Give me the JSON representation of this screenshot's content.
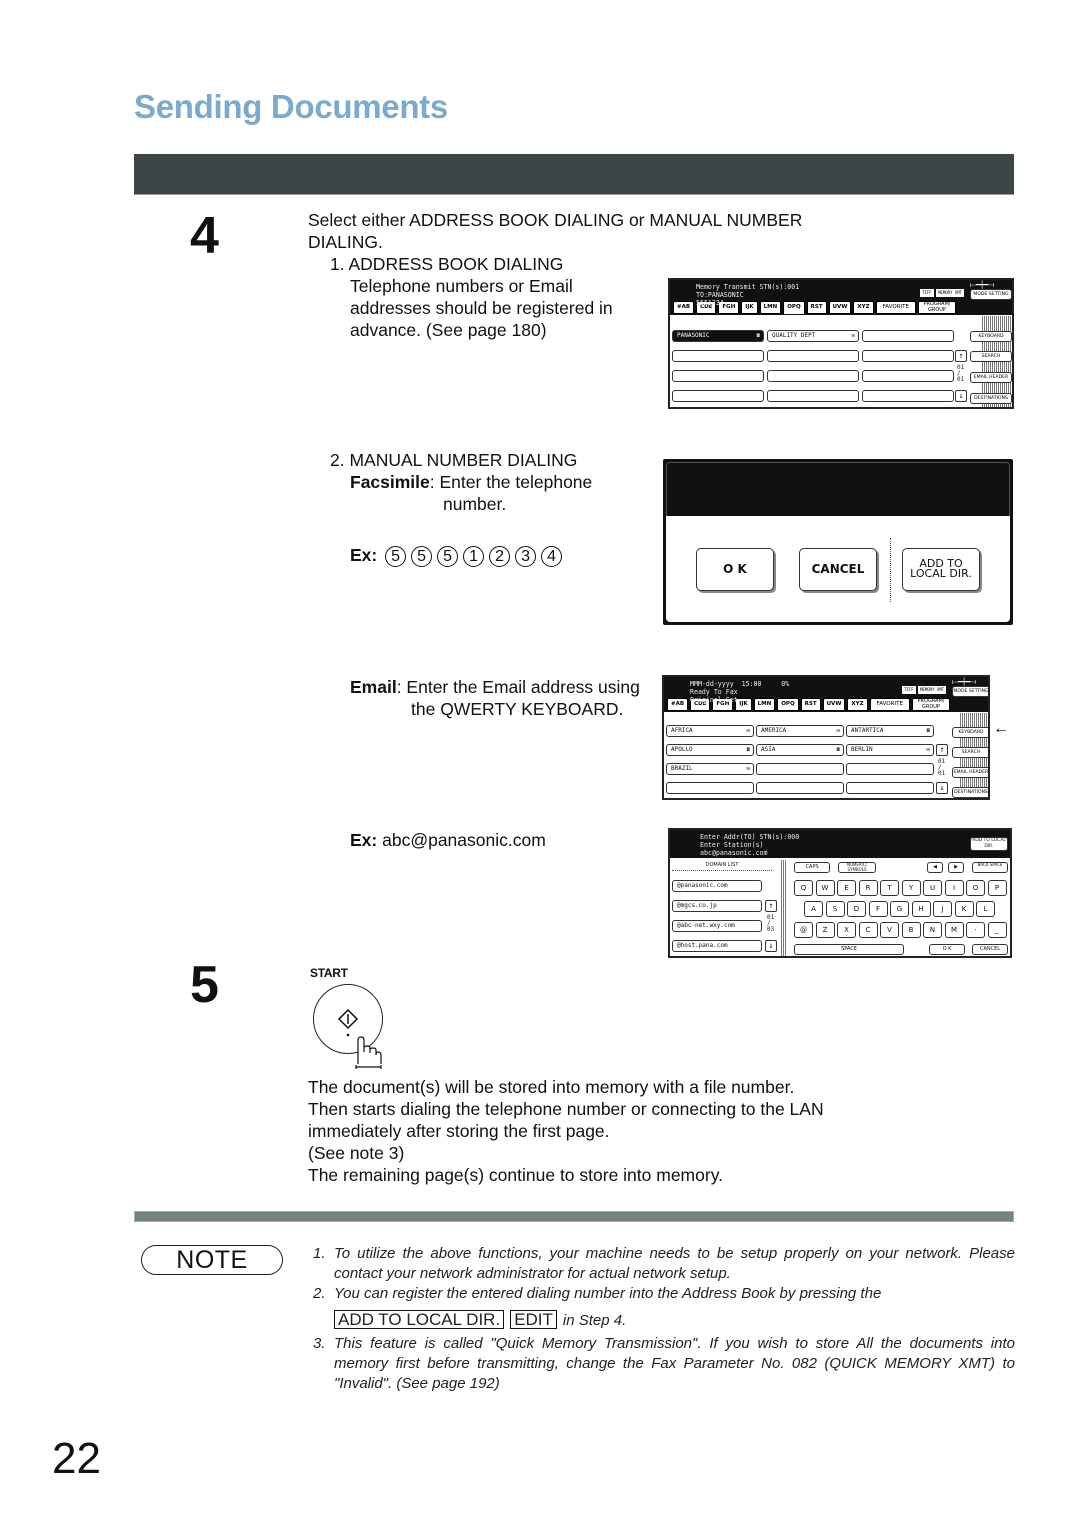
{
  "page": {
    "section_title": "Sending Documents",
    "page_number": "22"
  },
  "step4": {
    "number": "4",
    "intro_line1": "Select either ADDRESS BOOK DIALING or MANUAL NUMBER",
    "intro_line2": "DIALING.",
    "address_book": {
      "heading": "1. ADDRESS BOOK DIALING",
      "lines": [
        "Telephone numbers or Email",
        "addresses should be registered in",
        "advance. (See page 180)"
      ]
    },
    "manual": {
      "heading": "2. MANUAL NUMBER DIALING",
      "fax_label": "Facsimile",
      "fax_text_1": ": Enter the telephone",
      "fax_text_2": "number.",
      "ex_label": "Ex:",
      "ex_digits": [
        "5",
        "5",
        "5",
        "1",
        "2",
        "3",
        "4"
      ],
      "email_label": "Email",
      "email_text_1": ": Enter the Email address using",
      "email_text_2": "the QWERTY KEYBOARD.",
      "email_ex_label": "Ex:",
      "email_ex_value": "abc@panasonic.com"
    }
  },
  "screen_addressbook": {
    "status": [
      "Memory Transmit STN(s):001",
      "TO:PANASONIC",
      "5551234"
    ],
    "indicators": [
      "TIFF",
      "MEMORY XMT"
    ],
    "mode_setting": "MODE SETTING",
    "tabs": [
      "#AB",
      "CDE",
      "FGH",
      "IJK",
      "LMN",
      "OPQ",
      "RST",
      "UVW",
      "XYZ",
      "FAVORITE",
      "PROGRAM/ GROUP"
    ],
    "active_tab": "OPQ",
    "entries": [
      {
        "name": "PANASONIC",
        "type": "phone",
        "selected": true
      },
      {
        "name": "QUALITY DEPT",
        "type": "email",
        "selected": false
      }
    ],
    "side_buttons": [
      "KEYBOARD",
      "SEARCH",
      "EMAIL HEADER",
      "DESTINATIONS"
    ],
    "pager": {
      "current": "01",
      "total": "01"
    }
  },
  "screen_dialog": {
    "ok": "O K",
    "cancel": "CANCEL",
    "add_line1": "ADD TO",
    "add_line2": "LOCAL DIR."
  },
  "screen_ready": {
    "status": [
      "MMM-dd-yyyy  15:00     0%",
      "Ready To Fax",
      "Original Set"
    ],
    "indicators": [
      "TIFF",
      "MEMORY XMT"
    ],
    "mode_setting": "MODE SETTING",
    "tabs": [
      "#AB",
      "CDE",
      "FGH",
      "IJK",
      "LMN",
      "OPQ",
      "RST",
      "UVW",
      "XYZ",
      "FAVORITE",
      "PROGRAM/ GROUP"
    ],
    "entries": [
      {
        "name": "AFRICA",
        "icon": "✉"
      },
      {
        "name": "AMERICA",
        "icon": "✉"
      },
      {
        "name": "ANTARTICA",
        "icon": "☎"
      },
      {
        "name": "APOLLO",
        "icon": "☎"
      },
      {
        "name": "ASIA",
        "icon": "☎"
      },
      {
        "name": "BERLIN",
        "icon": "✉"
      },
      {
        "name": "BRAZIL",
        "icon": "✉"
      }
    ],
    "side_buttons": [
      "KEYBOARD",
      "SEARCH",
      "EMAIL HEADER",
      "DESTINATIONS"
    ],
    "pager": {
      "current": "01",
      "total": "01"
    },
    "pointer_arrow": "←"
  },
  "screen_keyboard": {
    "status": [
      "Enter Addr(TO) STN(s):000",
      "Enter Station(s)",
      "abc@panasonic.com"
    ],
    "add_to_local": "ADD TO LOCAL DIR.",
    "domain_list_title": "DOMAIN LIST",
    "domains": [
      "@panasonic.com",
      "@mgcs.co.jp",
      "@abc-net.wxy.com",
      "@host.pana.com"
    ],
    "pager": {
      "current": "01",
      "total": "03"
    },
    "top_buttons": [
      "CAPS",
      "NUMERIC/ SYMBOLS",
      "◀",
      "▶",
      "BACK SPACE"
    ],
    "rows": [
      [
        "Q",
        "W",
        "E",
        "R",
        "T",
        "Y",
        "U",
        "I",
        "O",
        "P"
      ],
      [
        "A",
        "S",
        "D",
        "F",
        "G",
        "H",
        "J",
        "K",
        "L"
      ],
      [
        "@",
        "Z",
        "X",
        "C",
        "V",
        "B",
        "N",
        "M",
        "·",
        "_"
      ]
    ],
    "space": "SPACE",
    "ok": "O K",
    "cancel": "CANCEL"
  },
  "step5": {
    "number": "5",
    "start_label": "START",
    "lines": [
      "The document(s) will be stored into memory with a file number.",
      "Then starts dialing the telephone number or connecting to the LAN",
      "immediately after storing the first page.",
      "(See note 3)",
      "The remaining page(s) continue to store into memory."
    ]
  },
  "note": {
    "label": "NOTE",
    "items": [
      {
        "n": "1.",
        "text": "To utilize the above functions, your machine needs to be setup properly on your network. Please contact your network administrator for actual network setup."
      },
      {
        "n": "2.",
        "text": "You can register the entered dialing number into the Address Book by pressing the"
      },
      {
        "n": "3.",
        "text": "This feature is called \"Quick Memory Transmission\". If you wish to store All the documents into memory first before transmitting, change the Fax Parameter No. 082 (QUICK MEMORY XMT) to \"Invalid\". (See page 192)"
      }
    ],
    "item2_button1": "ADD TO LOCAL DIR.",
    "item2_button2": "EDIT",
    "item2_suffix": "in Step 4."
  }
}
